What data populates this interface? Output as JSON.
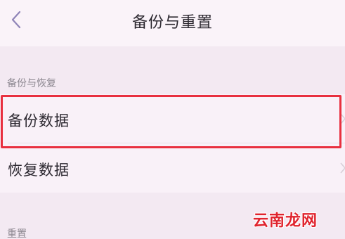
{
  "header": {
    "title": "备份与重置"
  },
  "sections": [
    {
      "label": "备份与恢复",
      "items": [
        {
          "label": "备份数据"
        },
        {
          "label": "恢复数据"
        }
      ]
    },
    {
      "label": "重置"
    }
  ],
  "watermark": "云南龙网",
  "colors": {
    "highlight": "#e8303f",
    "accent_back": "#8f84b8"
  },
  "icons": {
    "back": "chevron-left-icon",
    "row_arrow": "chevron-right-icon"
  }
}
